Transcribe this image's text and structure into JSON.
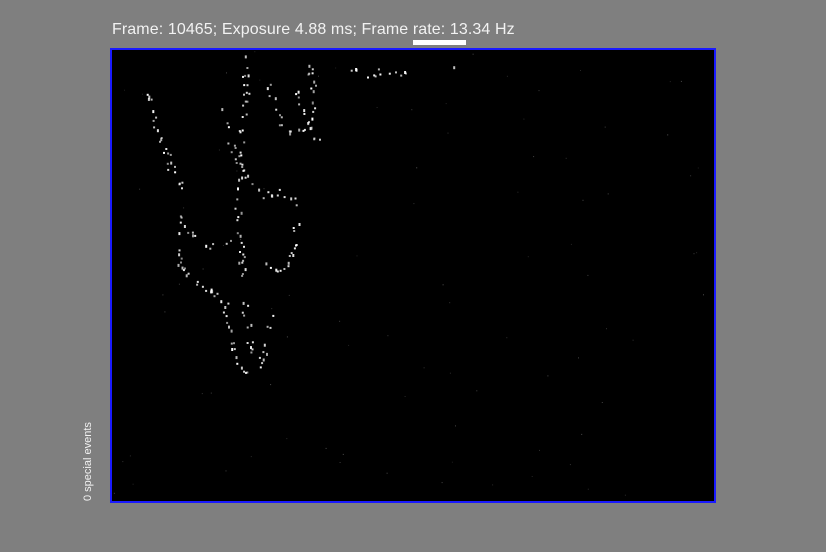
{
  "status": {
    "text": "Frame: 10465; Exposure 4.88 ms; Frame rate: 13.34 Hz",
    "progress": 1.0
  },
  "side_label": "0 special events",
  "colors": {
    "background": "#7f7f7f",
    "viewer_background": "#000000",
    "viewer_border": "#1a1aff",
    "event_dot": "#ffffff"
  }
}
